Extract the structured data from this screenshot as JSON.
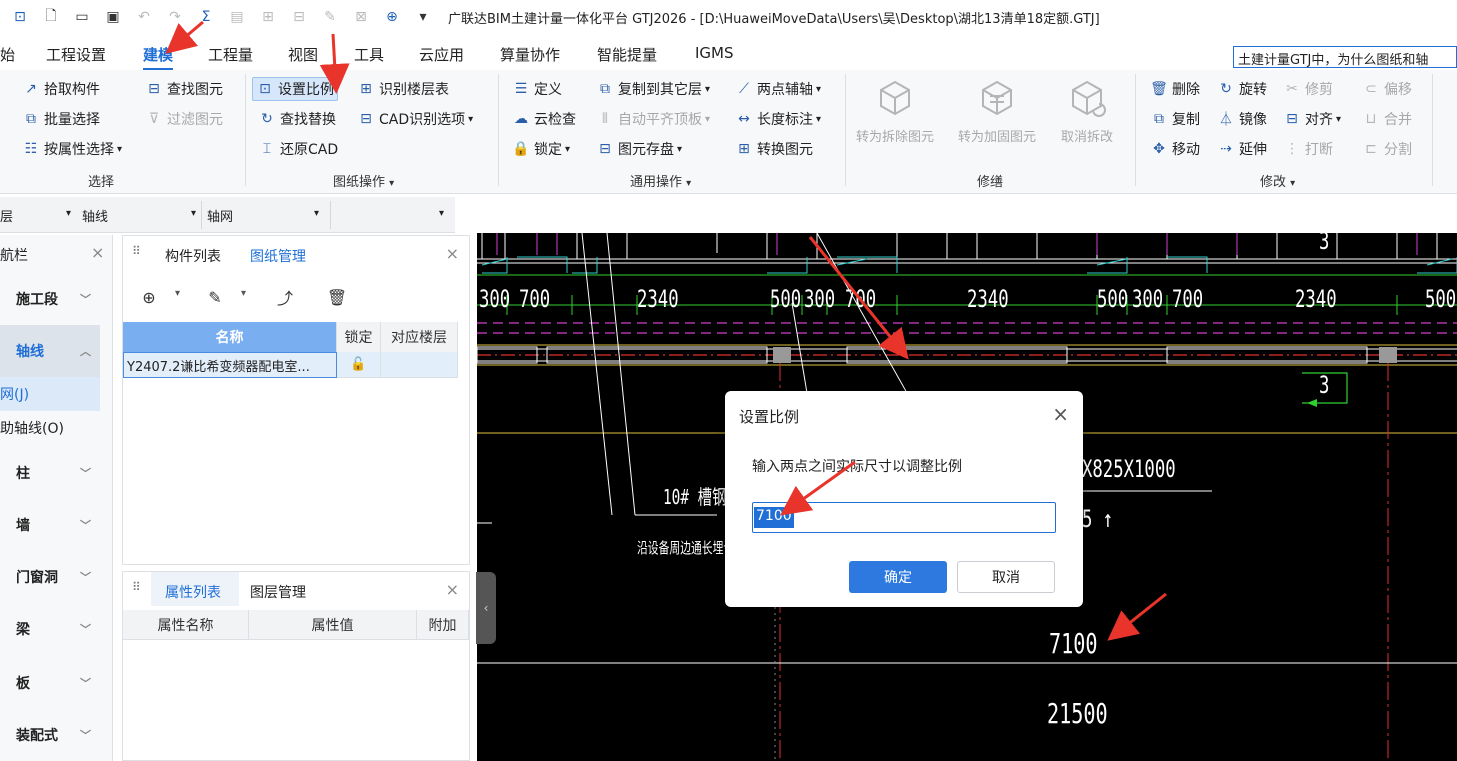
{
  "title": "广联达BIM土建计量一体化平台 GTJ2026 - [D:\\HuaweiMoveData\\Users\\吴\\Desktop\\湖北13清单18定额.GTJ]",
  "menu": {
    "tabs": [
      "始",
      "工程设置",
      "建模",
      "工程量",
      "视图",
      "工具",
      "云应用",
      "算量协作",
      "智能提量",
      "IGMS"
    ],
    "active": "建模",
    "search_value": "土建计量GTJ中，为什么图纸和轴"
  },
  "ribbon": {
    "select": {
      "pick": "拾取构件",
      "batch": "批量选择",
      "by_attr": "按属性选择",
      "label": "选择",
      "find": "查找图元",
      "filter": "过滤图元"
    },
    "drawing_ops": {
      "set_scale": "设置比例",
      "find_replace": "查找替换",
      "restore_cad": "还原CAD",
      "identify_floor": "识别楼层表",
      "cad_options": "CAD识别选项",
      "label": "图纸操作"
    },
    "common_ops": {
      "define": "定义",
      "cloud_check": "云检查",
      "lock": "锁定",
      "copy_floor": "复制到其它层",
      "auto_align": "自动平齐顶板",
      "save_elem": "图元存盘",
      "two_point_axis": "两点辅轴",
      "length_dim": "长度标注",
      "convert": "转换图元",
      "label": "通用操作"
    },
    "repair": {
      "to_demolish": "转为拆除图元",
      "to_reinforce": "转为加固图元",
      "cancel_demolish": "取消拆改",
      "label": "修缮"
    },
    "modify": {
      "delete": "删除",
      "rotate": "旋转",
      "trim": "修剪",
      "offset": "偏移",
      "copy": "复制",
      "mirror": "镜像",
      "align": "对齐",
      "merge": "合并",
      "move": "移动",
      "extend": "延伸",
      "break": "打断",
      "split": "分割",
      "label": "修改"
    }
  },
  "filterbar": {
    "first": "层",
    "second": "轴线",
    "third": "轴网"
  },
  "nav": {
    "title": "航栏",
    "items": [
      "施工段",
      "轴线",
      "柱",
      "墙",
      "门窗洞",
      "梁",
      "板",
      "装配式"
    ],
    "active": "轴线",
    "subitems": [
      "网(J)",
      "助轴线(O)"
    ]
  },
  "drawing_panel": {
    "tabs": [
      "构件列表",
      "图纸管理"
    ],
    "active_tab": "图纸管理",
    "columns": [
      "名称",
      "锁定",
      "对应楼层"
    ],
    "rows": [
      {
        "name": "Y2407.2谦比希变频器配电室...",
        "lock": "lock-icon",
        "floor": ""
      }
    ]
  },
  "prop_panel": {
    "tabs": [
      "属性列表",
      "图层管理"
    ],
    "active_tab": "属性列表",
    "columns": [
      "属性名称",
      "属性值",
      "附加"
    ]
  },
  "canvas": {
    "dims_top": [
      "300",
      "700",
      "2340",
      "500",
      "300",
      "700",
      "2340",
      "500",
      "300",
      "700",
      "2340",
      "500"
    ],
    "labels": {
      "num3_top": "3",
      "num3_mid": "3",
      "part": "X825X1000",
      "five": "5",
      "channel": "10#  槽钢",
      "note": "沿设备周边通长埋设",
      "dim_7100": "7100",
      "dim_21500": "21500"
    }
  },
  "dialog": {
    "title": "设置比例",
    "prompt": "输入两点之间实际尺寸以调整比例",
    "input_value": "7100",
    "ok": "确定",
    "cancel": "取消"
  },
  "colors": {
    "accent": "#1f6fd6",
    "canvas_bg": "#000000",
    "annotation_arrow": "#e8342a"
  }
}
